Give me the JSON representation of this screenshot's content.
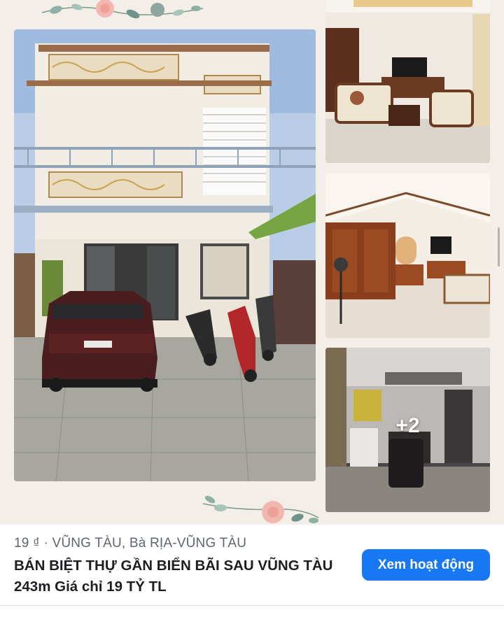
{
  "gallery": {
    "photos": [
      {
        "name": "villa-exterior"
      },
      {
        "name": "living-room"
      },
      {
        "name": "bedroom"
      },
      {
        "name": "kitchen"
      }
    ],
    "more_count": "+2"
  },
  "listing": {
    "meta": "19 ₫ · VŨNG TÀU, Bà RỊA-VŨNG TÀU",
    "title": "BÁN BIỆT THỰ GẦN BIỂN BÃI SAU VŨNG TÀU 243m Giá chỉ 19 TỶ TL",
    "action_label": "Xem hoạt động"
  },
  "colors": {
    "accent": "#1877f2",
    "meta_text": "#5f6670",
    "title_text": "#1c1e21",
    "gallery_bg": "#f4eee9"
  }
}
